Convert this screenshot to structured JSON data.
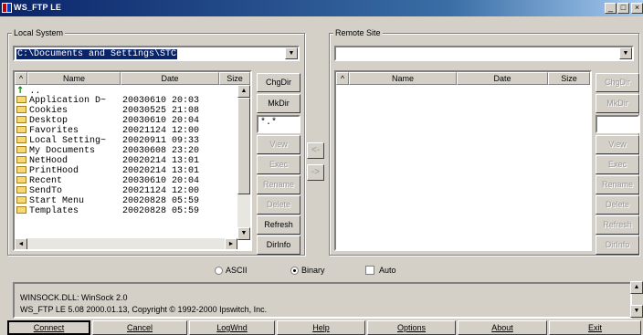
{
  "window": {
    "title": "WS_FTP LE",
    "controls": {
      "minimize": "_",
      "maximize": "□",
      "close": "×"
    }
  },
  "local": {
    "group_label": "Local System",
    "path": "C:\\Documents and Settings\\STC",
    "columns": [
      "^",
      "Name",
      "Date",
      "Size"
    ],
    "parent_dir": "..",
    "files": [
      {
        "name": "Application D~",
        "date": "20030610 20:03"
      },
      {
        "name": "Cookies",
        "date": "20030525 21:08"
      },
      {
        "name": "Desktop",
        "date": "20030610 20:04"
      },
      {
        "name": "Favorites",
        "date": "20021124 12:00"
      },
      {
        "name": "Local Setting~",
        "date": "20020911 09:33"
      },
      {
        "name": "My Documents",
        "date": "20030608 23:20"
      },
      {
        "name": "NetHood",
        "date": "20020214 13:01"
      },
      {
        "name": "PrintHood",
        "date": "20020214 13:01"
      },
      {
        "name": "Recent",
        "date": "20030610 20:04"
      },
      {
        "name": "SendTo",
        "date": "20021124 12:00"
      },
      {
        "name": "Start Menu",
        "date": "20020828 05:59"
      },
      {
        "name": "Templates",
        "date": "20020828 05:59"
      }
    ],
    "buttons": {
      "chgdir": "ChgDir",
      "mkdir": "MkDir",
      "mask": "*.*",
      "view": "View",
      "exec": "Exec",
      "rename": "Rename",
      "delete": "Delete",
      "refresh": "Refresh",
      "dirinfo": "DirInfo"
    }
  },
  "remote": {
    "group_label": "Remote Site",
    "path": "",
    "columns": [
      "^",
      "Name",
      "Date",
      "Size"
    ],
    "buttons": {
      "chgdir": "ChgDir",
      "mkdir": "MkDir",
      "mask": "",
      "view": "View",
      "exec": "Exec",
      "rename": "Rename",
      "delete": "Delete",
      "refresh": "Refresh",
      "dirinfo": "DirInfo"
    }
  },
  "transfer": {
    "left_arrow": "<-",
    "right_arrow": "->"
  },
  "mode": {
    "ascii": "ASCII",
    "binary": "Binary",
    "auto": "Auto",
    "selected": "binary",
    "auto_checked": false
  },
  "log": {
    "line1": "WINSOCK.DLL: WinSock 2.0",
    "line2": "WS_FTP LE 5.08 2000.01.13, Copyright © 1992-2000 Ipswitch, Inc."
  },
  "bottom_buttons": [
    "Connect",
    "Cancel",
    "LogWnd",
    "Help",
    "Options",
    "About",
    "Exit"
  ],
  "colors": {
    "title_start": "#0a246a",
    "title_end": "#a6caf0",
    "selection": "#0a246a",
    "folder": "#f8d870"
  }
}
